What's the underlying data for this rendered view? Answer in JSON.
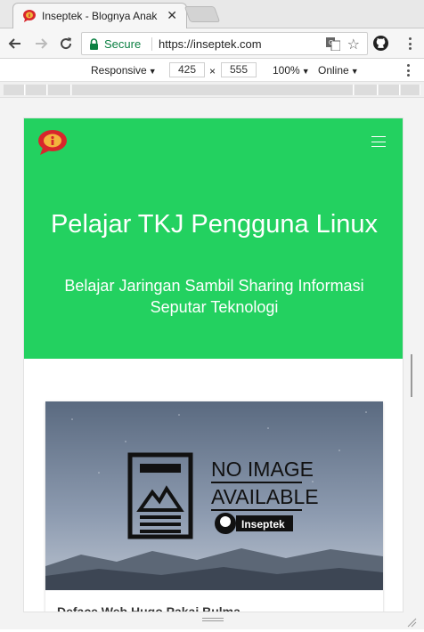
{
  "browser": {
    "tab_title": "Inseptek - Blognya Anak",
    "secure_label": "Secure",
    "url": "https://inseptek.com"
  },
  "device_toolbar": {
    "mode": "Responsive",
    "width": "425",
    "times": "×",
    "height": "555",
    "zoom": "100%",
    "network": "Online"
  },
  "page": {
    "hero_title": "Pelajar TKJ Pengguna Linux",
    "hero_subtitle": "Belajar Jaringan Sambil Sharing Informasi Seputar Teknologi",
    "card_image_text_1": "NO IMAGE",
    "card_image_text_2": "AVAILABLE",
    "card_image_brand": "Inseptek",
    "card_title": "Deface Web Hugo Pakai Bulma"
  },
  "colors": {
    "hero": "#23d160",
    "secure": "#0b8043"
  }
}
